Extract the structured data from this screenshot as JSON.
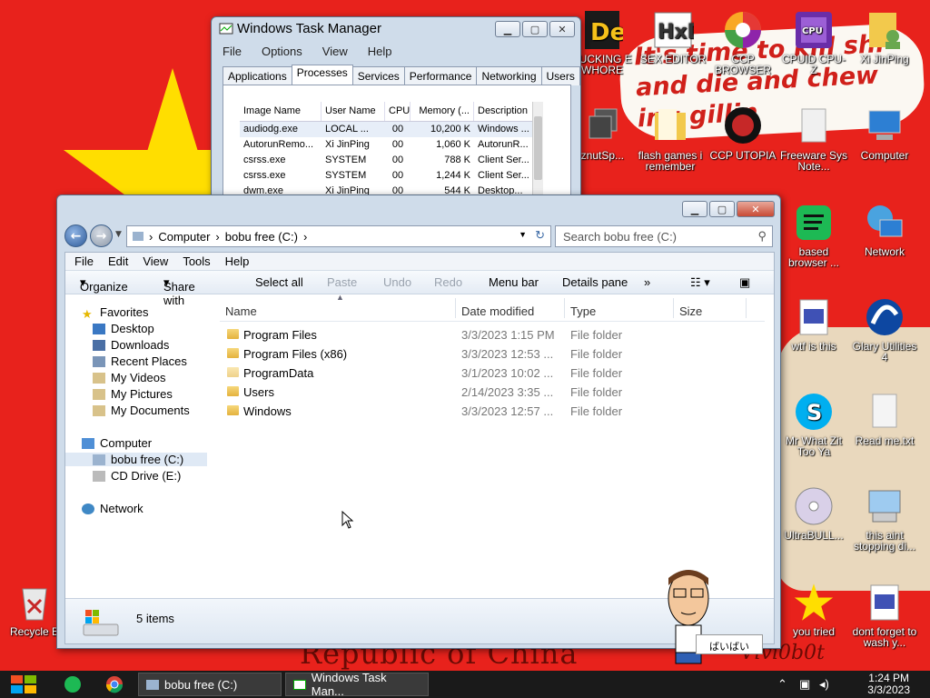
{
  "wallpaper": {
    "banner_text": "It's time to kill shi and die and chew ing gillin",
    "bottom_text": "Republic of China",
    "signature": "Vivi0b0t"
  },
  "desktop_icons": [
    {
      "id": "de",
      "label": "FUCKING E WHORE",
      "icon": "de-icon"
    },
    {
      "id": "sexeditor",
      "label": "SEX EDITOR",
      "icon": "hxd-icon"
    },
    {
      "id": "ccp-browser",
      "label": "CCP BROWSER",
      "icon": "browser-icon"
    },
    {
      "id": "cpuz",
      "label": "CPUID CPU-Z",
      "icon": "cpuz-icon"
    },
    {
      "id": "xijinping",
      "label": "Xi JinPing",
      "icon": "user-folder-icon"
    },
    {
      "id": "peanut",
      "label": "eznutSp...",
      "icon": "app-icon"
    },
    {
      "id": "flash",
      "label": "flash games i remember",
      "icon": "folder-icon"
    },
    {
      "id": "ccp-utopia",
      "label": "CCP UTOPIA",
      "icon": "ccp-utopia-icon"
    },
    {
      "id": "freeware",
      "label": "Freeware Sys Note...",
      "icon": "document-icon"
    },
    {
      "id": "computer",
      "label": "Computer",
      "icon": "computer-icon"
    },
    {
      "id": "based",
      "label": "based browser ...",
      "icon": "spotify-icon"
    },
    {
      "id": "network",
      "label": "Network",
      "icon": "network-icon"
    },
    {
      "id": "wtf",
      "label": "wtf is this",
      "icon": "calendar-icon"
    },
    {
      "id": "glary",
      "label": "Glary Utilities 4",
      "icon": "glary-icon"
    },
    {
      "id": "skype",
      "label": "Mr What Zit Too Ya",
      "icon": "skype-icon"
    },
    {
      "id": "readme",
      "label": "Read me.txt",
      "icon": "text-file-icon"
    },
    {
      "id": "ultrabull",
      "label": "UltraBULL...",
      "icon": "disc-icon"
    },
    {
      "id": "notstopping",
      "label": "this aint stopping di...",
      "icon": "installer-icon"
    },
    {
      "id": "youtried",
      "label": "you tried",
      "icon": "star-icon"
    },
    {
      "id": "dontforget",
      "label": "dont forget to wash y...",
      "icon": "calendar-icon"
    },
    {
      "id": "recycle",
      "label": "Recycle B",
      "icon": "recycle-bin-icon"
    }
  ],
  "task_manager": {
    "title": "Windows Task Manager",
    "menu": [
      "File",
      "Options",
      "View",
      "Help"
    ],
    "tabs": [
      "Applications",
      "Processes",
      "Services",
      "Performance",
      "Networking",
      "Users"
    ],
    "active_tab": "Processes",
    "columns": [
      "Image Name",
      "User Name",
      "CPU",
      "Memory (...",
      "Description"
    ],
    "rows": [
      [
        "audiodg.exe",
        "LOCAL ...",
        "00",
        "10,200 K",
        "Windows ..."
      ],
      [
        "AutorunRemo...",
        "Xi JinPing",
        "00",
        "1,060 K",
        "AutorunR..."
      ],
      [
        "csrss.exe",
        "SYSTEM",
        "00",
        "788 K",
        "Client Ser..."
      ],
      [
        "csrss.exe",
        "SYSTEM",
        "00",
        "1,244 K",
        "Client Ser..."
      ],
      [
        "dwm.exe",
        "Xi JinPing",
        "00",
        "544 K",
        "Desktop..."
      ]
    ]
  },
  "explorer": {
    "title": "",
    "address": [
      "Computer",
      "bobu free (C:)"
    ],
    "search_placeholder": "Search bobu free (C:)",
    "menu": [
      "File",
      "Edit",
      "View",
      "Tools",
      "Help"
    ],
    "toolbar": {
      "organize": "Organize",
      "share": "Share with",
      "select_all": "Select all",
      "paste": "Paste",
      "undo": "Undo",
      "redo": "Redo",
      "menu_bar": "Menu bar",
      "details_pane": "Details pane",
      "more": "»"
    },
    "nav": {
      "favorites": "Favorites",
      "desktop": "Desktop",
      "downloads": "Downloads",
      "recent": "Recent Places",
      "videos": "My Videos",
      "pictures": "My Pictures",
      "documents": "My Documents",
      "computer": "Computer",
      "drive_c": "bobu free (C:)",
      "drive_e": "CD Drive (E:)",
      "network": "Network"
    },
    "columns": [
      "Name",
      "Date modified",
      "Type",
      "Size"
    ],
    "files": [
      {
        "name": "Program Files",
        "date": "3/3/2023 1:15 PM",
        "type": "File folder"
      },
      {
        "name": "Program Files (x86)",
        "date": "3/3/2023 12:53 ...",
        "type": "File folder"
      },
      {
        "name": "ProgramData",
        "date": "3/1/2023 10:02 ...",
        "type": "File folder"
      },
      {
        "name": "Users",
        "date": "2/14/2023 3:35 ...",
        "type": "File folder"
      },
      {
        "name": "Windows",
        "date": "3/3/2023 12:57 ...",
        "type": "File folder"
      }
    ],
    "status": "5 items"
  },
  "mascot_speech": "ばいばい",
  "taskbar": {
    "tasks": [
      {
        "label": "bobu free (C:)",
        "icon": "explorer-icon"
      },
      {
        "label": "Windows Task Man...",
        "icon": "task-manager-icon"
      }
    ],
    "time": "1:24 PM",
    "date": "3/3/2023"
  },
  "colors": {
    "wallpaper_red": "#e8221c",
    "star_yellow": "#ffde00"
  }
}
